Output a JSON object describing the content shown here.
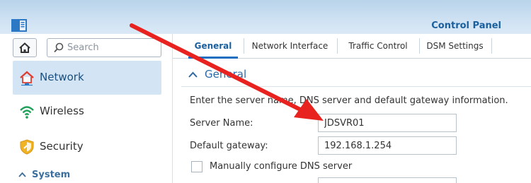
{
  "window": {
    "title": "Control Panel"
  },
  "search": {
    "placeholder": "Search"
  },
  "sidebar": {
    "items": [
      {
        "label": "Network",
        "icon": "network-icon"
      },
      {
        "label": "Wireless",
        "icon": "wifi-icon"
      },
      {
        "label": "Security",
        "icon": "shield-icon"
      }
    ],
    "section": "System"
  },
  "tabs": [
    "General",
    "Network Interface",
    "Traffic Control",
    "DSM Settings"
  ],
  "general": {
    "header": "General",
    "description": "Enter the server name, DNS server and default gateway information.",
    "server_name_label": "Server Name:",
    "server_name_value": "JDSVR01",
    "gateway_label": "Default gateway:",
    "gateway_value": "192.168.1.254",
    "dns_checkbox_label": "Manually configure DNS server"
  },
  "colors": {
    "accent": "#1a6fc0",
    "annotation_arrow": "#e8231f"
  }
}
